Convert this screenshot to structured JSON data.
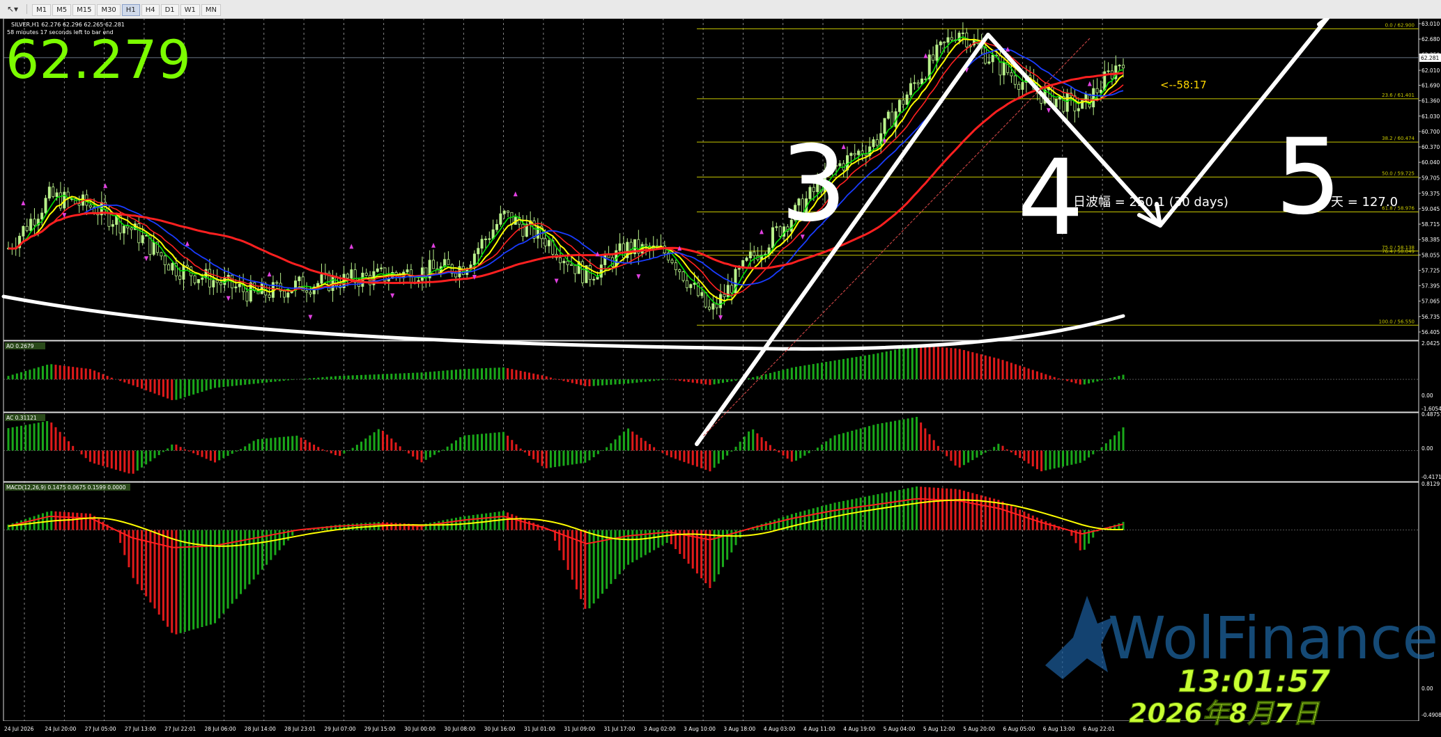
{
  "toolbar": {
    "tool_icon": "cursor-arrow-icon",
    "timeframes": [
      "M1",
      "M5",
      "M15",
      "M30",
      "H1",
      "H4",
      "D1",
      "W1",
      "MN"
    ],
    "active_timeframe": "H1"
  },
  "header": {
    "symbol_line": "SILVER,H1  62.276 62.296 62.265 62.281",
    "timer_line": "58 minutes 17 seconds left to bar end",
    "big_price": "62.279",
    "countdown": "<--58:17",
    "range_text": "日波幅 = 250.1  (30 days)",
    "today_text": "今天 = 127.0"
  },
  "price_axis": {
    "current_price": "62.281",
    "ticks": [
      "63.010",
      "62.680",
      "62.350",
      "62.010",
      "61.690",
      "61.360",
      "61.030",
      "60.700",
      "60.370",
      "60.040",
      "59.705",
      "59.375",
      "59.045",
      "58.715",
      "58.385",
      "58.055",
      "57.725",
      "57.395",
      "57.065",
      "56.735",
      "56.405"
    ]
  },
  "time_axis": {
    "labels": [
      "24 Jul 2026",
      "24 Jul 20:00",
      "27 Jul 05:00",
      "27 Jul 13:00",
      "27 Jul 22:01",
      "28 Jul 06:00",
      "28 Jul 14:00",
      "28 Jul 23:01",
      "29 Jul 07:00",
      "29 Jul 15:00",
      "30 Jul 00:00",
      "30 Jul 08:00",
      "30 Jul 16:00",
      "31 Jul 01:00",
      "31 Jul 09:00",
      "31 Jul 17:00",
      "3 Aug 02:00",
      "3 Aug 10:00",
      "3 Aug 18:00",
      "4 Aug 03:00",
      "4 Aug 11:00",
      "4 Aug 19:00",
      "5 Aug 04:00",
      "5 Aug 12:00",
      "5 Aug 20:00",
      "6 Aug 05:00",
      "6 Aug 13:00",
      "6 Aug 22:01"
    ]
  },
  "fibonacci": [
    {
      "label": "0.0  /  62.900",
      "price": 62.9
    },
    {
      "label": "23.6  /  61.401",
      "price": 61.401
    },
    {
      "label": "38.2  /  60.474",
      "price": 60.474
    },
    {
      "label": "50.0  /  59.725",
      "price": 59.725
    },
    {
      "label": "61.8  /  58.976",
      "price": 58.976
    },
    {
      "label": "75.0  /  58.138",
      "price": 58.138
    },
    {
      "label": "76.4  /  58.049",
      "price": 58.049
    },
    {
      "label": "100.0  /  56.550",
      "price": 56.55
    }
  ],
  "indicators": {
    "ao": {
      "label": "AO 0.2679",
      "ticks": [
        "2.0425",
        "0.00",
        "-1.6054"
      ]
    },
    "ac": {
      "label": "AC 0.31121",
      "ticks": [
        "0.48757",
        "0.00",
        "-0.41711"
      ]
    },
    "macd": {
      "label": "MACD(12,26,9) 0.1475 0.0675 0.1599 0.0000",
      "ticks": [
        "0.8129",
        "0.00",
        "-0.4908"
      ]
    }
  },
  "annotations": {
    "wave3": "3",
    "wave4": "4",
    "wave5": "5"
  },
  "watermark": {
    "brand": "WolFinance"
  },
  "stamp": {
    "time": "13:01:57",
    "date": "2026年8月7日"
  },
  "colors": {
    "background": "#000000",
    "candle": "#b8f08a",
    "price_green": "#7cfc00",
    "fib": "#c8c800",
    "ma_red": "#ff2020",
    "ma_yellow": "#ffff00",
    "ma_green": "#00e000",
    "ma_blue": "#1a3cff",
    "hist_up": "#1aa81a",
    "hist_down": "#e01a1a",
    "stamp": "#c8ff32"
  },
  "chart_data": {
    "type": "candlestick",
    "symbol": "SILVER",
    "timeframe": "H1",
    "ylim": [
      56.405,
      63.01
    ],
    "waypoints": [
      {
        "t": "24 Jul 2026",
        "price": 58.2
      },
      {
        "t": "24 Jul 20:00",
        "price": 59.3
      },
      {
        "t": "27 Jul 05:00",
        "price": 59.1
      },
      {
        "t": "27 Jul 13:00",
        "price": 58.6
      },
      {
        "t": "27 Jul 22:01",
        "price": 57.8
      },
      {
        "t": "28 Jul 06:00",
        "price": 57.5
      },
      {
        "t": "28 Jul 14:00",
        "price": 57.2
      },
      {
        "t": "28 Jul 23:01",
        "price": 57.4
      },
      {
        "t": "29 Jul 07:00",
        "price": 57.5
      },
      {
        "t": "29 Jul 15:00",
        "price": 57.6
      },
      {
        "t": "30 Jul 00:00",
        "price": 57.7
      },
      {
        "t": "30 Jul 08:00",
        "price": 57.8
      },
      {
        "t": "30 Jul 16:00",
        "price": 58.9
      },
      {
        "t": "31 Jul 01:00",
        "price": 58.4
      },
      {
        "t": "31 Jul 09:00",
        "price": 57.6
      },
      {
        "t": "31 Jul 17:00",
        "price": 58.2
      },
      {
        "t": "3 Aug 02:00",
        "price": 58.1
      },
      {
        "t": "3 Aug 10:00",
        "price": 56.8
      },
      {
        "t": "3 Aug 18:00",
        "price": 58.0
      },
      {
        "t": "4 Aug 03:00",
        "price": 58.9
      },
      {
        "t": "4 Aug 11:00",
        "price": 59.9
      },
      {
        "t": "4 Aug 19:00",
        "price": 60.5
      },
      {
        "t": "5 Aug 04:00",
        "price": 61.8
      },
      {
        "t": "5 Aug 12:00",
        "price": 62.9
      },
      {
        "t": "5 Aug 20:00",
        "price": 62.1
      },
      {
        "t": "6 Aug 05:00",
        "price": 61.5
      },
      {
        "t": "6 Aug 13:00",
        "price": 61.2
      },
      {
        "t": "6 Aug 22:01",
        "price": 62.28
      }
    ],
    "ao_waypoints": [
      0.2,
      0.9,
      0.6,
      -0.4,
      -1.5,
      -0.6,
      -0.3,
      0.0,
      0.2,
      0.3,
      0.4,
      0.6,
      0.7,
      0.2,
      -0.5,
      -0.3,
      0.0,
      -0.4,
      0.1,
      0.7,
      1.1,
      1.5,
      2.0,
      1.8,
      1.2,
      0.4,
      -0.4,
      0.27
    ],
    "ac_waypoints": [
      0.3,
      0.4,
      -0.2,
      -0.4,
      0.1,
      -0.2,
      0.15,
      0.2,
      -0.1,
      0.3,
      -0.2,
      0.2,
      0.25,
      -0.3,
      -0.2,
      0.3,
      -0.1,
      -0.35,
      0.3,
      -0.2,
      0.2,
      0.35,
      0.45,
      -0.3,
      0.1,
      -0.35,
      -0.2,
      0.31
    ],
    "macd_waypoints": [
      0.1,
      0.35,
      0.3,
      -0.2,
      -0.45,
      -0.4,
      -0.2,
      0.0,
      0.1,
      0.15,
      0.1,
      0.25,
      0.35,
      0.05,
      -0.35,
      -0.15,
      -0.05,
      -0.25,
      0.05,
      0.3,
      0.5,
      0.65,
      0.8,
      0.75,
      0.55,
      0.2,
      -0.1,
      0.15
    ]
  }
}
